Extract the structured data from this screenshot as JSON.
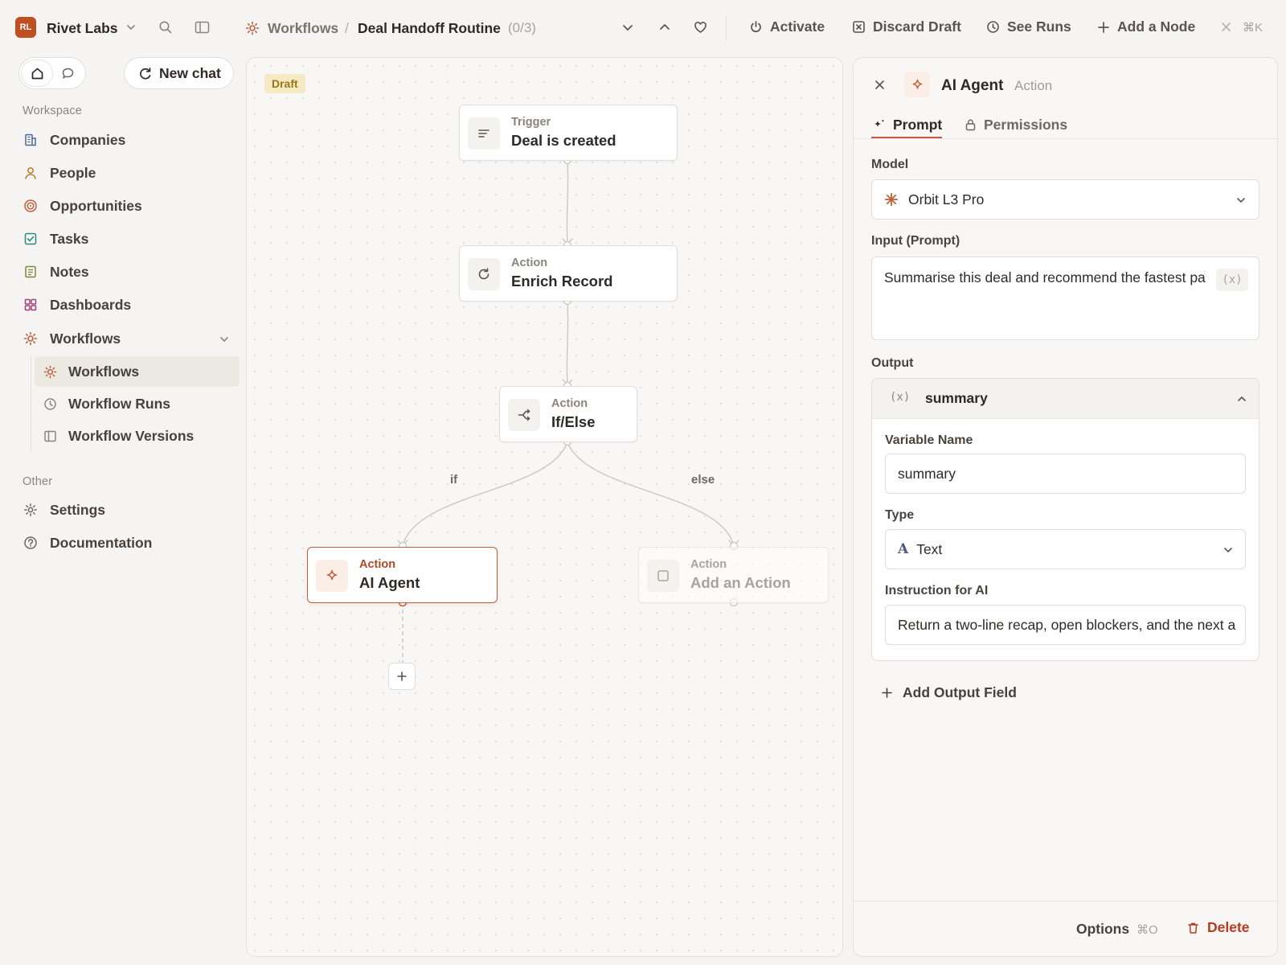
{
  "workspace": {
    "initials": "RL",
    "name": "Rivet Labs"
  },
  "breadcrumb": {
    "section": "Workflows",
    "separator": "/",
    "title": "Deal Handoff Routine",
    "count": "(0/3)"
  },
  "toolbar": {
    "activate": "Activate",
    "discard": "Discard Draft",
    "see_runs": "See Runs",
    "add_node": "Add a Node",
    "shortcut": "⌘K"
  },
  "sidebar": {
    "new_chat": "New chat",
    "workspace_label": "Workspace",
    "items": [
      {
        "label": "Companies",
        "icon": "building-icon"
      },
      {
        "label": "People",
        "icon": "person-icon"
      },
      {
        "label": "Opportunities",
        "icon": "target-icon"
      },
      {
        "label": "Tasks",
        "icon": "checkbox-icon"
      },
      {
        "label": "Notes",
        "icon": "note-icon"
      },
      {
        "label": "Dashboards",
        "icon": "grid-icon"
      },
      {
        "label": "Workflows",
        "icon": "workflow-icon"
      }
    ],
    "sub_items": [
      {
        "label": "Workflows",
        "icon": "workflow-icon"
      },
      {
        "label": "Workflow Runs",
        "icon": "clock-icon"
      },
      {
        "label": "Workflow Versions",
        "icon": "version-icon"
      }
    ],
    "other_label": "Other",
    "other_items": [
      {
        "label": "Settings",
        "icon": "gear-icon"
      },
      {
        "label": "Documentation",
        "icon": "help-icon"
      }
    ]
  },
  "canvas": {
    "badge": "Draft",
    "nodes": {
      "trigger": {
        "type": "Trigger",
        "name": "Deal is created"
      },
      "enrich": {
        "type": "Action",
        "name": "Enrich Record"
      },
      "ifelse": {
        "type": "Action",
        "name": "If/Else"
      },
      "agent": {
        "type": "Action",
        "name": "AI Agent"
      },
      "placeholder": {
        "type": "Action",
        "name": "Add an Action"
      }
    },
    "branch_if": "if",
    "branch_else": "else"
  },
  "panel": {
    "title": "AI Agent",
    "subtitle": "Action",
    "tabs": [
      "Prompt",
      "Permissions"
    ],
    "model_label": "Model",
    "model_value": "Orbit L3 Pro",
    "input_label": "Input (Prompt)",
    "input_value": "Summarise this deal and recommend the fastest pa",
    "var_chip": "(x)",
    "output_label": "Output",
    "output": {
      "var_icon": "(x)",
      "name": "summary",
      "var_name_label": "Variable Name",
      "var_name_value": "summary",
      "type_label": "Type",
      "type_glyph": "A",
      "type_value": "Text",
      "instruction_label": "Instruction for AI",
      "instruction_value": "Return a two-line recap, open blockers, and the next a"
    },
    "add_output": "Add Output Field",
    "options": "Options",
    "options_shortcut": "⌘O",
    "delete": "Delete"
  },
  "colors": {
    "accent": "#c0603a",
    "brand": "#bf4f21",
    "danger": "#b93a1c",
    "draft_bg": "#f6eac4"
  }
}
